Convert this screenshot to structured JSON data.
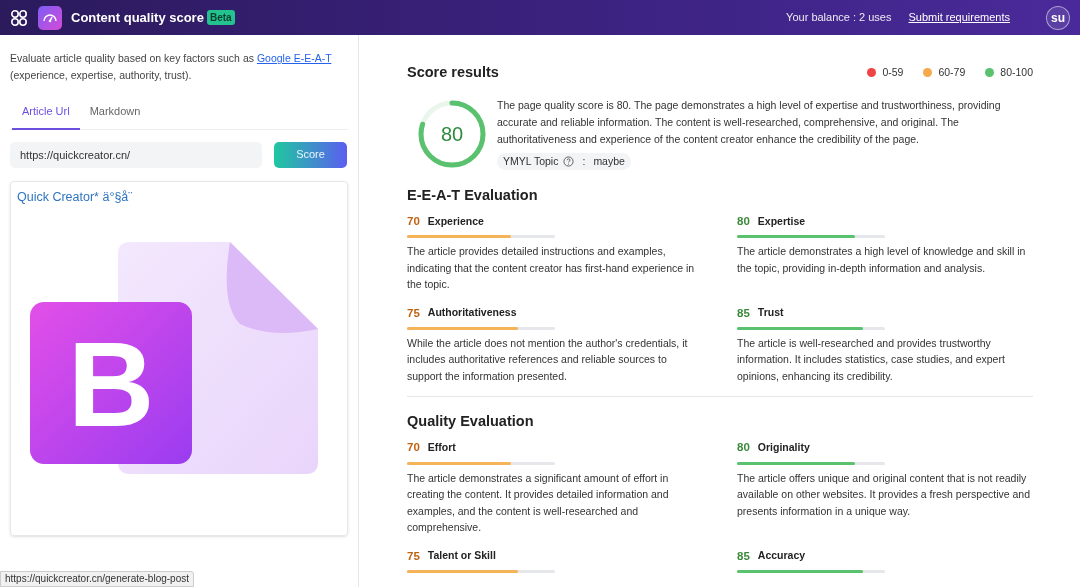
{
  "header": {
    "title": "Content quality score",
    "badge": "Beta",
    "balance": "Your balance : 2 uses",
    "link": "Submit requirements",
    "avatar": "su"
  },
  "sidebar": {
    "intro": {
      "before": "Evaluate article quality based on key factors such as",
      "link": "Google E-E-A-T",
      "after": "(experience, expertise, authority, trust)."
    },
    "tabs": [
      {
        "label": "Article Url",
        "selected": true
      },
      {
        "label": "Markdown",
        "selected": false
      }
    ],
    "url_field": {
      "value": "https://quickcreator.cn/"
    },
    "score_button": "Score",
    "preview": {
      "title": "Quick Creator* ä°§å¨",
      "logo_letter": "B"
    }
  },
  "results": {
    "title": "Score results",
    "legend": [
      {
        "label": "0-59",
        "color": "#ef4444"
      },
      {
        "label": "60-79",
        "color": "#f5a94a"
      },
      {
        "label": "80-100",
        "color": "#5ac26e"
      }
    ],
    "score": {
      "value": "80"
    },
    "summary": "The page quality score is 80. The page demonstrates a high level of expertise and trustworthiness, providing accurate and reliable information. The content is well-researched, comprehensive, and original. The authoritativeness and experience of the content creator enhance the credibility of the page.",
    "ymyl": {
      "label": "YMYL Topic",
      "separator": ":",
      "value": "maybe"
    },
    "sections": [
      {
        "title": "E-E-A-T Evaluation",
        "items": [
          {
            "score": "70",
            "name": "Experience",
            "level": 0.7,
            "text": "The article provides detailed instructions and examples, indicating that the content creator has first-hand experience in the topic."
          },
          {
            "score": "80",
            "name": "Expertise",
            "level": 0.8,
            "text": "The article demonstrates a high level of knowledge and skill in the topic, providing in-depth information and analysis."
          },
          {
            "score": "75",
            "name": "Authoritativeness",
            "level": 0.75,
            "text": "While the article does not mention the author's credentials, it includes authoritative references and reliable sources to support the information presented."
          },
          {
            "score": "85",
            "name": "Trust",
            "level": 0.85,
            "text": "The article is well-researched and provides trustworthy information. It includes statistics, case studies, and expert opinions, enhancing its credibility."
          }
        ]
      },
      {
        "title": "Quality Evaluation",
        "items": [
          {
            "score": "70",
            "name": "Effort",
            "level": 0.7,
            "text": "The article demonstrates a significant amount of effort in creating the content. It provides detailed information and examples, and the content is well-researched and comprehensive."
          },
          {
            "score": "80",
            "name": "Originality",
            "level": 0.8,
            "text": "The article offers unique and original content that is not readily available on other websites. It provides a fresh perspective and presents information in a unique way."
          },
          {
            "score": "75",
            "name": "Talent or Skill",
            "level": 0.75
          },
          {
            "score": "85",
            "name": "Accuracy",
            "level": 0.85
          }
        ]
      }
    ]
  },
  "status_url": "https://quickcreator.cn/generate-blog-post"
}
